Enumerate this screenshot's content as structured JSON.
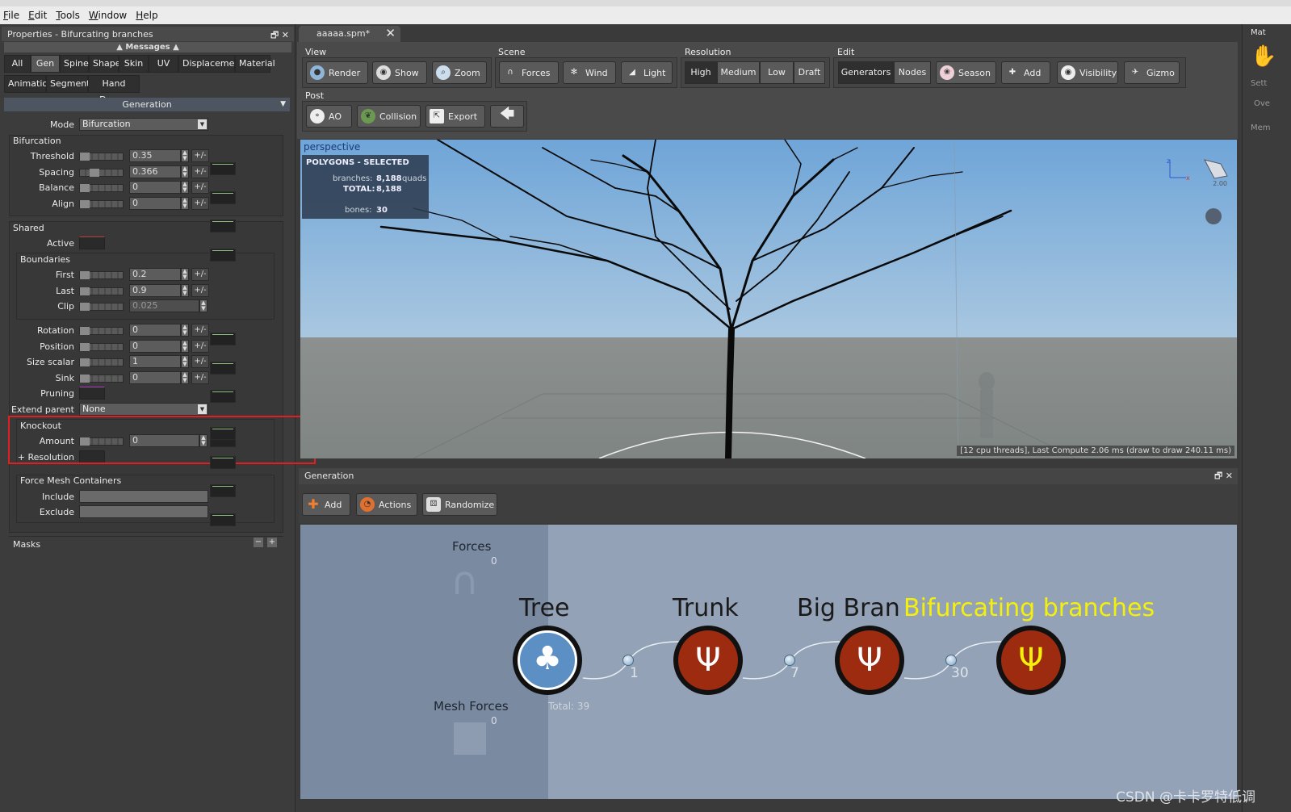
{
  "window": {
    "menus": [
      "File",
      "Edit",
      "Tools",
      "Window",
      "Help"
    ]
  },
  "left_panel": {
    "title": "Properties - Bifurcating branches",
    "messages": "Messages",
    "tabs_row1": [
      "All",
      "Gen",
      "Spine",
      "Shape",
      "Skin",
      "UV",
      "Displacement",
      "Material"
    ],
    "tabs_row2": [
      "Animation",
      "Segments",
      "Hand Drawn"
    ],
    "active_tab": "Gen",
    "section": "Generation",
    "mode_label": "Mode",
    "mode_value": "Bifurcation",
    "bifurcation": {
      "title": "Bifurcation",
      "rows": [
        {
          "label": "Threshold",
          "value": "0.35"
        },
        {
          "label": "Spacing",
          "value": "0.366"
        },
        {
          "label": "Balance",
          "value": "0"
        },
        {
          "label": "Align",
          "value": "0"
        }
      ]
    },
    "shared": {
      "title": "Shared",
      "active_label": "Active",
      "boundaries_title": "Boundaries",
      "boundaries": [
        {
          "label": "First",
          "value": "0.2"
        },
        {
          "label": "Last",
          "value": "0.9"
        },
        {
          "label": "Clip",
          "value": "0.025"
        }
      ],
      "rows": [
        {
          "label": "Rotation",
          "value": "0"
        },
        {
          "label": "Position",
          "value": "0"
        },
        {
          "label": "Size scalar",
          "value": "1"
        },
        {
          "label": "Sink",
          "value": "0"
        }
      ],
      "pruning_label": "Pruning",
      "extend_parent_label": "Extend parent",
      "extend_parent_value": "None"
    },
    "knockout": {
      "title": "Knockout",
      "amount_label": "Amount",
      "amount_value": "0",
      "resolution_label": "+ Resolution"
    },
    "force_mesh": {
      "title": "Force Mesh Containers",
      "include_label": "Include",
      "exclude_label": "Exclude"
    },
    "masks_label": "Masks",
    "pm_label": "+/-"
  },
  "document_tab": "aaaaa.spm*",
  "toolbar": {
    "view": {
      "label": "View",
      "buttons": [
        "Render",
        "Show",
        "Zoom"
      ]
    },
    "scene": {
      "label": "Scene",
      "buttons": [
        "Forces",
        "Wind",
        "Light"
      ]
    },
    "resolution": {
      "label": "Resolution",
      "options": [
        "High",
        "Medium",
        "Low",
        "Draft"
      ],
      "selected": "High"
    },
    "edit": {
      "label": "Edit",
      "modes": [
        "Generators",
        "Nodes"
      ],
      "selected": "Generators",
      "buttons": [
        "Season",
        "Add",
        "Visibility",
        "Gizmo"
      ]
    },
    "post": {
      "label": "Post",
      "buttons": [
        "AO",
        "Collision",
        "Export"
      ]
    }
  },
  "viewport": {
    "camera_label": "perspective",
    "stats_title": "POLYGONS - SELECTED",
    "branches_label": "branches:",
    "branches_value": "8,188",
    "branches_unit": "quads",
    "total_label": "TOTAL:",
    "total_value": "8,188",
    "bones_label": "bones:",
    "bones_value": "30",
    "perf_text": "[12 cpu threads], Last Compute 2.06 ms (draw to draw 240.11 ms)",
    "light_value": "2.00"
  },
  "generation_panel": {
    "title": "Generation",
    "buttons": [
      "Add",
      "Actions",
      "Randomize"
    ],
    "forces_label": "Forces",
    "forces_count": "0",
    "mesh_forces_label": "Mesh Forces",
    "mesh_forces_count": "0",
    "total_label": "Total: 39",
    "nodes": [
      {
        "title": "Tree",
        "color": "#5c8fc4"
      },
      {
        "title": "Trunk",
        "color": "#9c2b10"
      },
      {
        "title": "Big Bran",
        "color": "#9c2b10"
      },
      {
        "title": "Bifurcating branches",
        "color": "#9c2b10",
        "highlight": "#f4f00a"
      }
    ],
    "counts": [
      "1",
      "7",
      "30"
    ]
  },
  "right_panel": {
    "labels": [
      "Mat",
      "Sett",
      "Ove",
      "Mem",
      "Mat"
    ]
  },
  "watermark": "CSDN @卡卡罗特低调"
}
